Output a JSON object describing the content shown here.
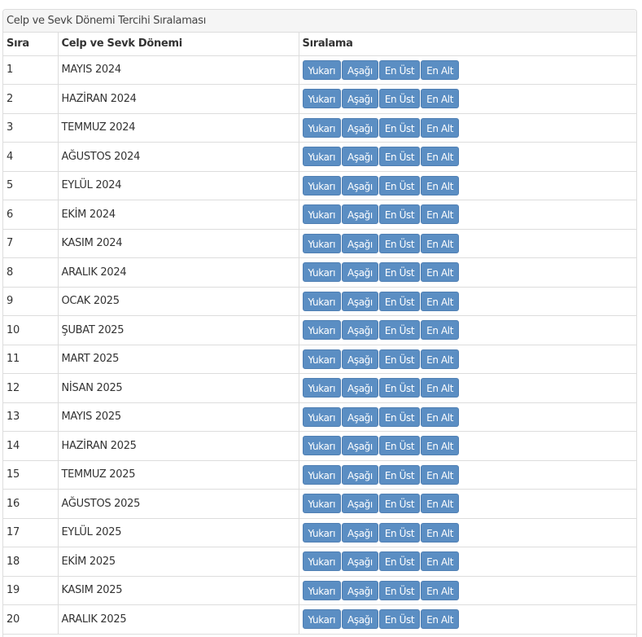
{
  "panel": {
    "title": "Celp ve Sevk Dönemi Tercihi Sıralaması"
  },
  "table": {
    "headers": [
      "Sıra",
      "Celp ve Sevk Dönemi",
      "Sıralama"
    ],
    "button_labels": {
      "up": "Yukarı",
      "down": "Aşağı",
      "top": "En Üst",
      "bottom": "En Alt"
    },
    "rows": [
      {
        "sira": "1",
        "donem": "MAYIS 2024"
      },
      {
        "sira": "2",
        "donem": "HAZİRAN 2024"
      },
      {
        "sira": "3",
        "donem": "TEMMUZ 2024"
      },
      {
        "sira": "4",
        "donem": "AĞUSTOS 2024"
      },
      {
        "sira": "5",
        "donem": "EYLÜL 2024"
      },
      {
        "sira": "6",
        "donem": "EKİM 2024"
      },
      {
        "sira": "7",
        "donem": "KASIM 2024"
      },
      {
        "sira": "8",
        "donem": "ARALIK 2024"
      },
      {
        "sira": "9",
        "donem": "OCAK 2025"
      },
      {
        "sira": "10",
        "donem": "ŞUBAT 2025"
      },
      {
        "sira": "11",
        "donem": "MART 2025"
      },
      {
        "sira": "12",
        "donem": "NİSAN 2025"
      },
      {
        "sira": "13",
        "donem": "MAYIS 2025"
      },
      {
        "sira": "14",
        "donem": "HAZİRAN 2025"
      },
      {
        "sira": "15",
        "donem": "TEMMUZ 2025"
      },
      {
        "sira": "16",
        "donem": "AĞUSTOS 2025"
      },
      {
        "sira": "17",
        "donem": "EYLÜL 2025"
      },
      {
        "sira": "18",
        "donem": "EKİM 2025"
      },
      {
        "sira": "19",
        "donem": "KASIM 2025"
      },
      {
        "sira": "20",
        "donem": "ARALIK 2025"
      }
    ]
  },
  "colors": {
    "button_bg": "#5b8ec3",
    "button_text": "#ffffff",
    "heading_bg": "#f5f5f5",
    "border": "#dddddd"
  }
}
